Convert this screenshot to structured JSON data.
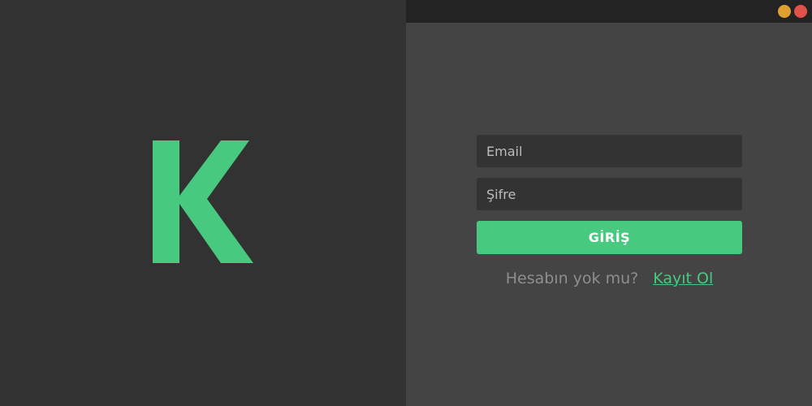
{
  "colors": {
    "accent": "#48c980",
    "minimize": "#e0a030",
    "close": "#e0524a"
  },
  "brand": {
    "logo_letter": "K"
  },
  "window_controls": {
    "minimize_icon": "minimize-dot",
    "close_icon": "close-dot"
  },
  "login_form": {
    "email_placeholder": "Email",
    "email_value": "",
    "password_placeholder": "Şifre",
    "password_value": "",
    "submit_label": "GİRİŞ"
  },
  "signup": {
    "prompt": "Hesabın yok mu?",
    "link_label": "Kayıt Ol"
  }
}
